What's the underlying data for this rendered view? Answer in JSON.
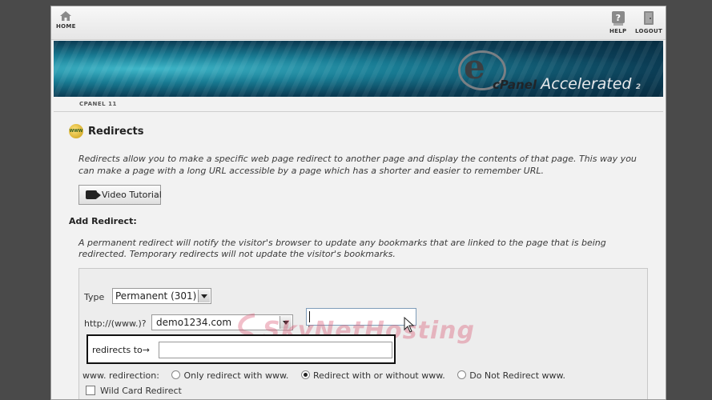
{
  "nav": {
    "home": "HOME",
    "help": "HELP",
    "logout": "LOGOUT"
  },
  "banner": {
    "logo_brand": "cPanel",
    "logo_accelerated": "Accelerated",
    "logo_version": "2"
  },
  "version_label": "CPANEL 11",
  "page": {
    "title": "Redirects",
    "description": "Redirects allow you to make a specific web page redirect to another page and display the contents of that page. This way you can make a page with a long URL accessible by a page which has a shorter and easier to remember URL.",
    "video_button": "Video Tutorial",
    "add_heading": "Add Redirect:",
    "perm_description": "A permanent redirect will notify the visitor's browser to update any bookmarks that are linked to the page that is being redirected. Temporary redirects will not update the visitor's bookmarks."
  },
  "form": {
    "type_label": "Type",
    "type_value": "Permanent (301)",
    "http_label": "http://(www.)?",
    "domain_value": "demo1234.com",
    "slash": "/",
    "path_value": "",
    "redirects_to_label": "redirects to→",
    "redirects_to_value": "",
    "www_label": "www. redirection:",
    "www_options": [
      {
        "label": "Only redirect with www.",
        "selected": false
      },
      {
        "label": "Redirect with or without www.",
        "selected": true
      },
      {
        "label": "Do Not Redirect www.",
        "selected": false
      }
    ],
    "wildcard_label": "Wild Card Redirect",
    "wildcard_checked": false
  },
  "watermark_text": "SkyNetHosting",
  "colors": {
    "banner_dark": "#0b3d55",
    "banner_light": "#3fb7c9",
    "panel_bg": "#f2f2f2",
    "watermark": "#d94b6a"
  },
  "icons": {
    "home": "home-icon",
    "help": "help-icon",
    "logout": "logout-icon",
    "www": "www-globe-icon",
    "video": "camera-icon"
  }
}
